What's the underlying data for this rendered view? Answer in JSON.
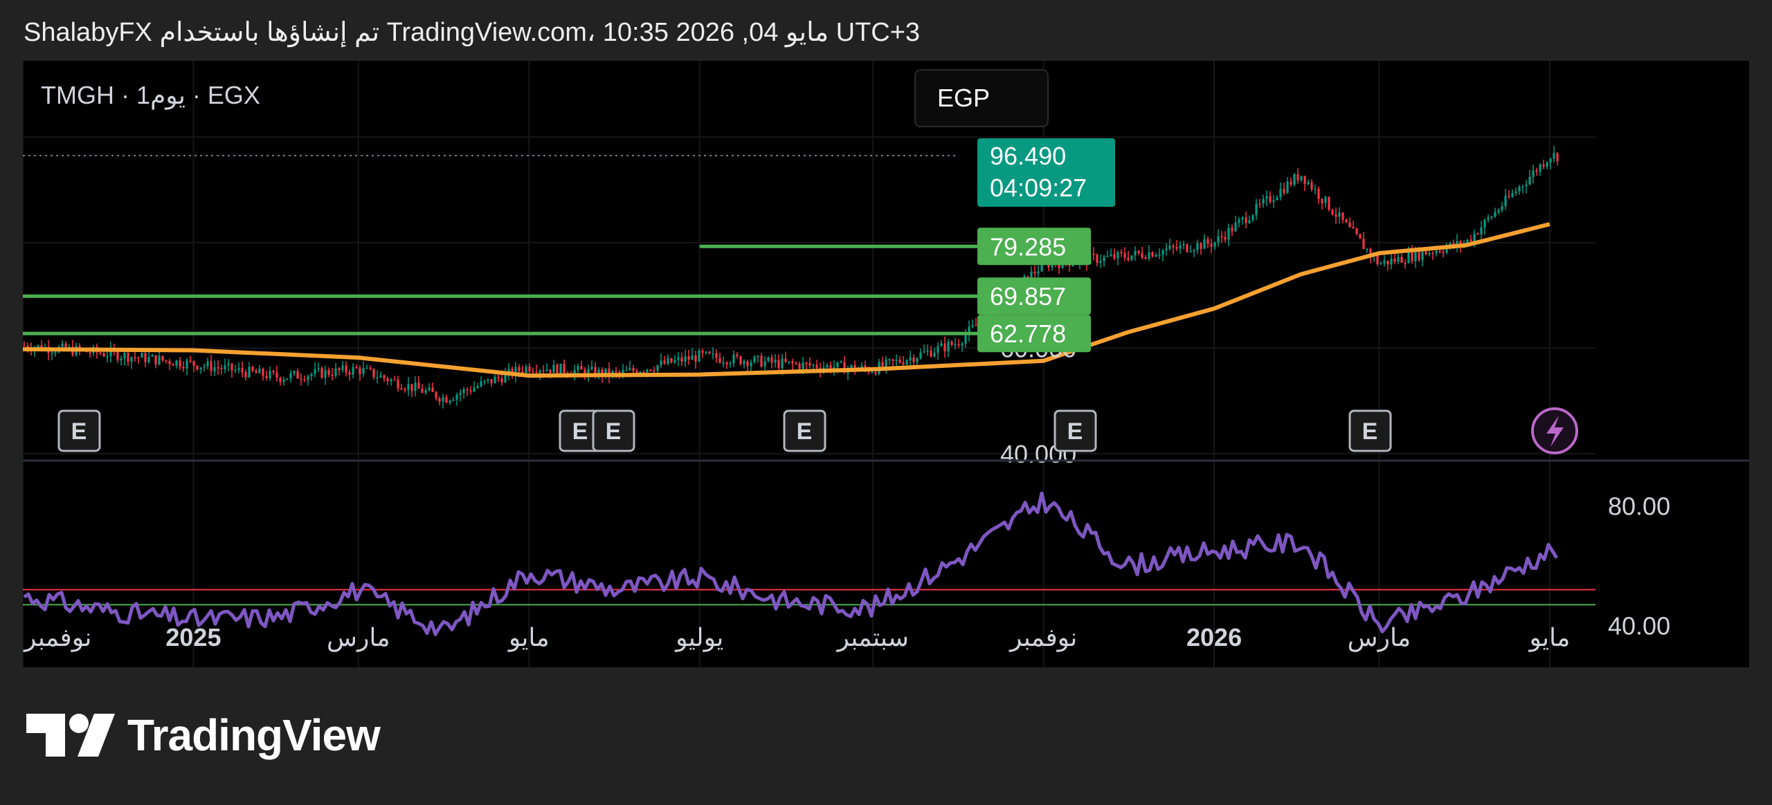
{
  "header": {
    "attribution": "ShalabyFX تم إنشاؤها باستخدام TradingView.com، 10:35 2026 ,04 مايو UTC+3"
  },
  "chart_data": {
    "type": "candlestick",
    "symbol_title": "TMGH · 1يوم · EGX",
    "currency_button": "EGP",
    "price_axis": {
      "min": 40.0,
      "max": 102.0,
      "tick_labels": [
        "60.000",
        "40.000"
      ],
      "last_price": "96.490",
      "countdown": "04:09:27"
    },
    "horizontal_levels": [
      {
        "label": "79.285",
        "value": 79.285,
        "starts_at": "2025-07"
      },
      {
        "label": "69.857",
        "value": 69.857,
        "starts_at": "2024-11"
      },
      {
        "label": "62.778",
        "value": 62.778,
        "starts_at": "2024-11"
      }
    ],
    "x_axis_labels": [
      "نوفمبر",
      "2025",
      "مارس",
      "مايو",
      "يوليو",
      "سبتمبر",
      "نوفمبر",
      "2026",
      "مارس",
      "مايو"
    ],
    "earnings_markers": [
      "E",
      "E",
      "E",
      "E",
      "E",
      "E"
    ],
    "close_series_monthly": {
      "x": [
        "2024-11",
        "2024-12",
        "2025-01",
        "2025-02",
        "2025-03",
        "2025-04",
        "2025-05",
        "2025-06",
        "2025-07",
        "2025-08",
        "2025-09",
        "2025-10",
        "2025-11",
        "2025-12",
        "2026-01",
        "2026-02",
        "2026-03",
        "2026-04",
        "2026-05"
      ],
      "close": [
        60.5,
        59.0,
        57.0,
        54.5,
        56.0,
        50.5,
        56.5,
        55.0,
        58.5,
        57.0,
        56.0,
        61.0,
        76.0,
        77.5,
        80.0,
        93.0,
        76.0,
        80.0,
        96.5
      ]
    },
    "moving_average": {
      "name": "",
      "color": "#f7a130",
      "x": [
        "2024-11",
        "2025-01",
        "2025-03",
        "2025-05",
        "2025-07",
        "2025-09",
        "2025-11",
        "2025-12",
        "2026-01",
        "2026-02",
        "2026-03",
        "2026-04",
        "2026-05"
      ],
      "values": [
        59.8,
        59.6,
        58.2,
        54.8,
        55.0,
        56.0,
        57.6,
        63.0,
        67.5,
        74.0,
        78.0,
        79.5,
        83.5
      ]
    },
    "oscillator": {
      "name": "",
      "color": "#7e57c2",
      "range": [
        30,
        90
      ],
      "tick_labels": [
        "80.00",
        "40.00"
      ],
      "upper_line": {
        "value": 52,
        "color": "#f23645"
      },
      "lower_line": {
        "value": 47,
        "color": "#4caf50"
      },
      "x": [
        "2024-11",
        "2024-12",
        "2025-01",
        "2025-02",
        "2025-03",
        "2025-04",
        "2025-05",
        "2025-06",
        "2025-07",
        "2025-08",
        "2025-09",
        "2025-10",
        "2025-11",
        "2025-12",
        "2026-01",
        "2026-02",
        "2026-03",
        "2026-04",
        "2026-05"
      ],
      "values": [
        50,
        45,
        42,
        43,
        52,
        38,
        58,
        52,
        56,
        48,
        46,
        62,
        82,
        60,
        65,
        68,
        40,
        50,
        65
      ]
    }
  },
  "footer": {
    "brand": "TradingView"
  },
  "icons": {
    "alert": "lightning-bolt-icon",
    "logo": "tradingview-logo-icon"
  }
}
